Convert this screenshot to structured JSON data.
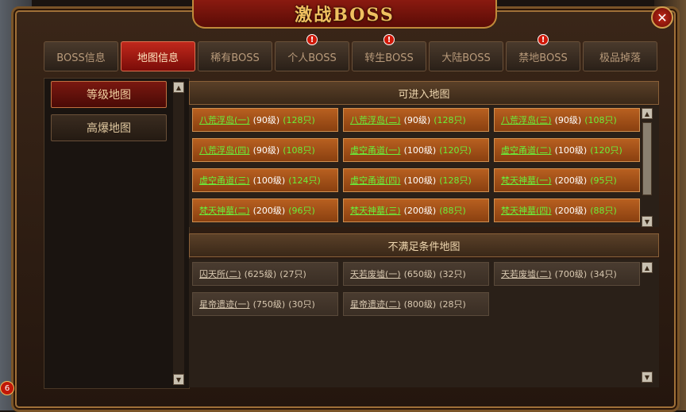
{
  "window": {
    "title": "激战BOSS",
    "close_label": "✕"
  },
  "tabs": [
    {
      "label": "BOSS信息",
      "active": false,
      "alert": false
    },
    {
      "label": "地图信息",
      "active": true,
      "alert": false
    },
    {
      "label": "稀有BOSS",
      "active": false,
      "alert": false
    },
    {
      "label": "个人BOSS",
      "active": false,
      "alert": true
    },
    {
      "label": "转生BOSS",
      "active": false,
      "alert": true
    },
    {
      "label": "大陆BOSS",
      "active": false,
      "alert": false
    },
    {
      "label": "禁地BOSS",
      "active": false,
      "alert": true
    },
    {
      "label": "极品掉落",
      "active": false,
      "alert": false
    }
  ],
  "alert_mark": "!",
  "sidebar": {
    "items": [
      {
        "label": "等级地图",
        "active": true
      },
      {
        "label": "高爆地图",
        "active": false
      }
    ]
  },
  "enterable": {
    "title": "可进入地图",
    "maps": [
      {
        "name": "八荒浮岛(一)",
        "level": "(90级)",
        "count": "(128只)"
      },
      {
        "name": "八荒浮岛(二)",
        "level": "(90级)",
        "count": "(128只)"
      },
      {
        "name": "八荒浮岛(三)",
        "level": "(90级)",
        "count": "(108只)"
      },
      {
        "name": "八荒浮岛(四)",
        "level": "(90级)",
        "count": "(108只)"
      },
      {
        "name": "虚空甬道(一)",
        "level": "(100级)",
        "count": "(120只)"
      },
      {
        "name": "虚空甬道(二)",
        "level": "(100级)",
        "count": "(120只)"
      },
      {
        "name": "虚空甬道(三)",
        "level": "(100级)",
        "count": "(124只)"
      },
      {
        "name": "虚空甬道(四)",
        "level": "(100级)",
        "count": "(128只)"
      },
      {
        "name": "梵天神墓(一)",
        "level": "(200级)",
        "count": "(95只)"
      },
      {
        "name": "梵天神墓(二)",
        "level": "(200级)",
        "count": "(96只)"
      },
      {
        "name": "梵天神墓(三)",
        "level": "(200级)",
        "count": "(88只)"
      },
      {
        "name": "梵天神墓(四)",
        "level": "(200级)",
        "count": "(88只)"
      }
    ]
  },
  "locked": {
    "title": "不满足条件地图",
    "maps": [
      {
        "name": "囚天所(二)",
        "level": "(625级)",
        "count": "(27只)"
      },
      {
        "name": "天若废墟(一)",
        "level": "(650级)",
        "count": "(32只)"
      },
      {
        "name": "天若废墟(二)",
        "level": "(700级)",
        "count": "(34只)"
      },
      {
        "name": "星帝遗迹(一)",
        "level": "(750级)",
        "count": "(30只)"
      },
      {
        "name": "星帝遗迹(二)",
        "level": "(800级)",
        "count": "(28只)"
      }
    ]
  },
  "scroll": {
    "up": "▲",
    "down": "▼"
  },
  "corner_badge": "6",
  "colors": {
    "active_tab": "#c0281c",
    "enterable_name": "#6af03a",
    "cell_orange": "#b86020"
  }
}
